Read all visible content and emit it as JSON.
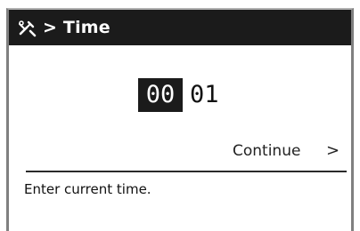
{
  "header": {
    "icon": "settings-tools-icon",
    "title": "> Time"
  },
  "time": {
    "hours": "00",
    "minutes": "01",
    "selected_field": "hours"
  },
  "actions": {
    "continue_label": "Continue",
    "continue_arrow": ">"
  },
  "status": {
    "message": "Enter current time."
  },
  "colors": {
    "header_bg": "#1b1b1b",
    "selected_bg": "#1b1b1b",
    "text": "#111111",
    "frame": "#808080"
  }
}
